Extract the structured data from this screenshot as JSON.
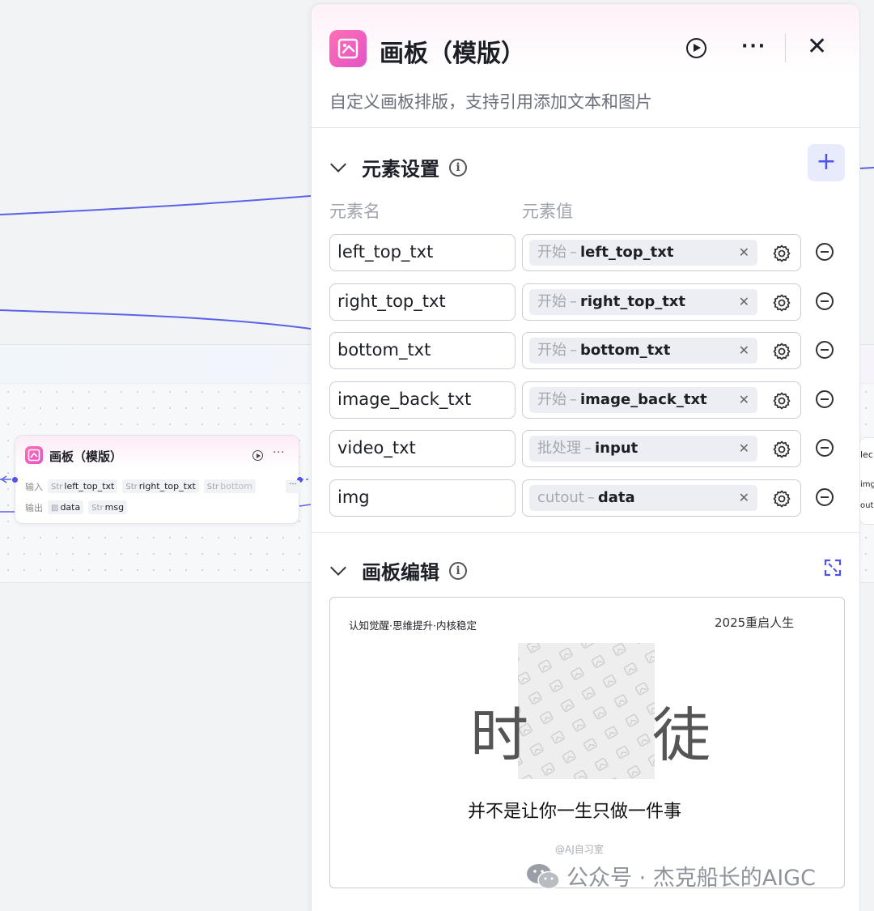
{
  "panel": {
    "title": "画板（模版）",
    "description": "自定义画板排版，支持引用添加文本和图片",
    "colors": {
      "accent": "#4d53e8",
      "icon_gradient_start": "#ff6fb5",
      "icon_gradient_end": "#e254c6"
    }
  },
  "element_settings": {
    "title": "元素设置",
    "info_icon": "info-circle-icon",
    "col_name": "元素名",
    "col_value": "元素值",
    "rows": [
      {
        "name": "left_top_txt",
        "source": "开始",
        "sep": "–",
        "var": "left_top_txt"
      },
      {
        "name": "right_top_txt",
        "source": "开始",
        "sep": "–",
        "var": "right_top_txt"
      },
      {
        "name": "bottom_txt",
        "source": "开始",
        "sep": "–",
        "var": "bottom_txt"
      },
      {
        "name": "image_back_txt",
        "source": "开始",
        "sep": "–",
        "var": "image_back_txt"
      },
      {
        "name": "video_txt",
        "source": "批处理",
        "sep": "–",
        "var": "input"
      },
      {
        "name": "img",
        "source": "cutout",
        "sep": "–",
        "var": "data"
      }
    ]
  },
  "board_edit": {
    "title": "画板编辑",
    "left_top": "认知觉醒·思维提升·内核稳定",
    "right_top": "2025重启人生",
    "big_left": "时",
    "big_right": "徒",
    "bottom": "并不是让你一生只做一件事",
    "watermark": "@AJ自习室"
  },
  "node": {
    "title": "画板（模版）",
    "input_label": "输入",
    "output_label": "输出",
    "inputs": [
      {
        "type": "Str",
        "name": "left_top_txt"
      },
      {
        "type": "Str",
        "name": "right_top_txt"
      },
      {
        "type": "Str",
        "name": "bottom"
      }
    ],
    "more_label": "···",
    "outputs": [
      {
        "type": "img",
        "name": "data"
      },
      {
        "type": "Str",
        "name": "msg"
      }
    ]
  },
  "right_stub": {
    "line1": "lec",
    "line2": "img",
    "line3": "out"
  },
  "footer": {
    "wechat_text": "公众号 · 杰克船长的AIGC"
  }
}
